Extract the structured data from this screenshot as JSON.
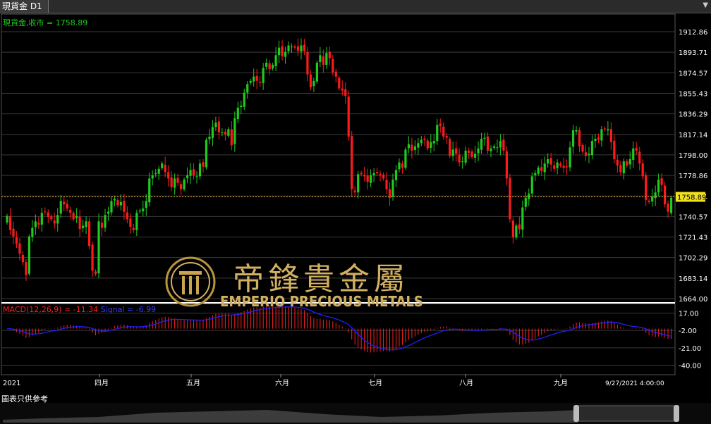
{
  "window": {
    "tab_title": "現貨金 D1",
    "menu_icon": "chevron-down-icon"
  },
  "watermark": {
    "chinese": "帝鋒貴金屬",
    "english": "EMPERIO PRECIOUS METALS"
  },
  "footer_note": "圖表只供參考",
  "colors": {
    "up": "#1ecb1e",
    "down": "#ff1a1a",
    "macd_hist": "#ff2020",
    "signal": "#2020ff",
    "price_line": "#e8a020",
    "grid": "#3a3a3a",
    "axis_text": "#ffffff",
    "legend_price": "#1ecb1e",
    "legend_macd": "#ff2020",
    "legend_signal": "#3a3aff"
  },
  "chart_data": [
    {
      "type": "candlestick",
      "legend": "現貨金,收市 = 1758.89",
      "y_ticks": [
        "1912.86",
        "1893.71",
        "1874.57",
        "1855.43",
        "1836.29",
        "1817.14",
        "1798.00",
        "1778.86",
        "1759.71",
        "1740.57",
        "1721.43",
        "1702.29",
        "1683.14",
        "1664.00"
      ],
      "ylim": [
        1664.0,
        1912.86
      ],
      "last_price": 1758.89,
      "last_price_label": "1758.89",
      "x_labels": [
        "2021",
        "四月",
        "五月",
        "六月",
        "七月",
        "八月",
        "九月",
        "9/27/2021 4:00:00"
      ],
      "close": [
        1741,
        1728,
        1722,
        1715,
        1706,
        1698,
        1686,
        1722,
        1730,
        1736,
        1733,
        1744,
        1745,
        1740,
        1738,
        1734,
        1742,
        1755,
        1752,
        1748,
        1744,
        1738,
        1741,
        1729,
        1732,
        1736,
        1713,
        1690,
        1687,
        1736,
        1730,
        1742,
        1745,
        1755,
        1757,
        1751,
        1754,
        1745,
        1738,
        1731,
        1728,
        1744,
        1746,
        1748,
        1755,
        1776,
        1779,
        1781,
        1785,
        1790,
        1782,
        1776,
        1768,
        1776,
        1772,
        1766,
        1775,
        1779,
        1784,
        1779,
        1778,
        1790,
        1787,
        1812,
        1815,
        1824,
        1828,
        1819,
        1819,
        1817,
        1822,
        1807,
        1832,
        1842,
        1844,
        1856,
        1864,
        1867,
        1871,
        1867,
        1865,
        1879,
        1884,
        1878,
        1882,
        1891,
        1898,
        1890,
        1894,
        1900,
        1899,
        1898,
        1895,
        1900,
        1895,
        1873,
        1861,
        1867,
        1884,
        1891,
        1882,
        1893,
        1888,
        1875,
        1871,
        1860,
        1858,
        1853,
        1815,
        1766,
        1763,
        1780,
        1780,
        1778,
        1773,
        1779,
        1781,
        1781,
        1779,
        1776,
        1766,
        1758,
        1775,
        1784,
        1791,
        1786,
        1803,
        1808,
        1802,
        1806,
        1809,
        1812,
        1812,
        1804,
        1810,
        1811,
        1826,
        1825,
        1815,
        1814,
        1797,
        1803,
        1799,
        1791,
        1792,
        1802,
        1800,
        1796,
        1799,
        1804,
        1813,
        1814,
        1802,
        1804,
        1806,
        1805,
        1811,
        1802,
        1776,
        1738,
        1721,
        1732,
        1729,
        1749,
        1758,
        1762,
        1778,
        1781,
        1786,
        1783,
        1790,
        1794,
        1789,
        1785,
        1791,
        1788,
        1786,
        1787,
        1805,
        1821,
        1821,
        1806,
        1801,
        1797,
        1799,
        1811,
        1813,
        1812,
        1822,
        1822,
        1822,
        1810,
        1794,
        1788,
        1782,
        1792,
        1788,
        1794,
        1804,
        1802,
        1790,
        1778,
        1756,
        1754,
        1759,
        1763,
        1775,
        1770,
        1752,
        1745,
        1758
      ]
    },
    {
      "type": "line+bar",
      "legend_macd": "MACD(12,26,9) = -11.34",
      "legend_signal": "Signal = -6.99",
      "y_ticks": [
        "17.00",
        "-2.00",
        "-21.00",
        "-40.00"
      ],
      "ylim": [
        -45,
        22
      ],
      "macd_last": -11.34,
      "signal_last": -6.99
    }
  ]
}
